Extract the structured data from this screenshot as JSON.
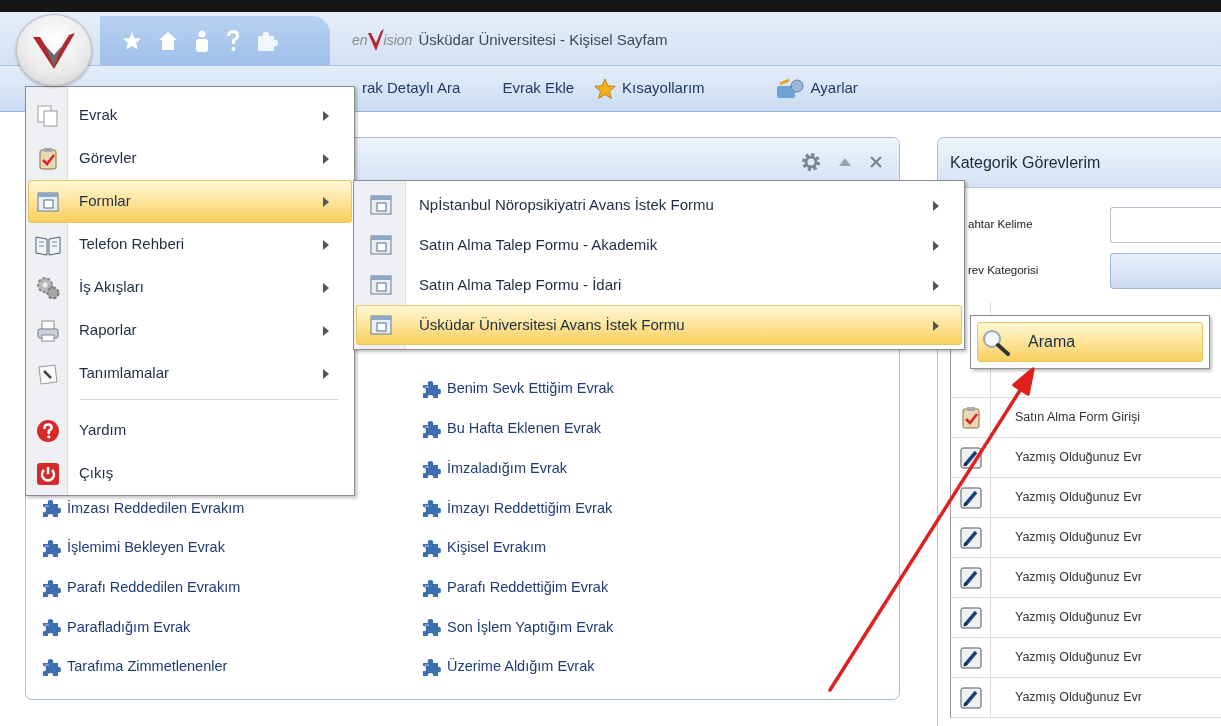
{
  "title_bar": {
    "logo": {
      "before": "en",
      "after": "ision"
    },
    "title": "Üsküdar Üniversitesi - Kişisel Sayfam"
  },
  "menu_bar": [
    {
      "label": "rak Detaylı Ara",
      "kind": "plain"
    },
    {
      "label": "Evrak Ekle",
      "kind": "plain"
    },
    {
      "label": "Kısayollarım",
      "kind": "star"
    },
    {
      "label": "Ayarlar",
      "kind": "settings"
    }
  ],
  "left_panel": {
    "columns": [
      [
        "İmzası Reddedilen Evrakım",
        "İşlemimi Bekleyen Evrak",
        "Parafı Reddedilen Evrakım",
        "Parafladığım Evrak",
        "Tarafıma Zimmetlenenler"
      ],
      [
        "Benim Sevk Ettiğim Evrak",
        "Bu Hafta Eklenen Evrak",
        "İmzaladığım Evrak",
        "İmzayı Reddettiğim Evrak",
        "Kişisel Evrakım",
        "Parafı Reddettiğim Evrak",
        "Son İşlem Yaptığım Evrak",
        "Üzerime Aldığım Evrak"
      ]
    ]
  },
  "right_panel": {
    "title": "Kategorik Görevlerim",
    "fields": [
      {
        "label": "ahtar Kelime",
        "kind": "text"
      },
      {
        "label": "rev Kategorisi",
        "kind": "dropdown"
      }
    ],
    "rows": [
      {
        "kind": "task",
        "text": "Satın Alma Form Girişi"
      },
      {
        "kind": "document",
        "text": "Yazmış Olduğunuz Evr"
      },
      {
        "kind": "document",
        "text": "Yazmış Olduğunuz Evr"
      },
      {
        "kind": "document",
        "text": "Yazmış Olduğunuz Evr"
      },
      {
        "kind": "document",
        "text": "Yazmış Olduğunuz Evr"
      },
      {
        "kind": "document",
        "text": "Yazmış Olduğunuz Evr"
      },
      {
        "kind": "document",
        "text": "Yazmış Olduğunuz Evr"
      },
      {
        "kind": "document",
        "text": "Yazmış Olduğunuz Evr"
      }
    ]
  },
  "start_menu": {
    "items": [
      {
        "label": "Evrak",
        "kind": "documents",
        "has_submenu": true,
        "separator_before": false,
        "selected": false
      },
      {
        "label": "Görevler",
        "kind": "clipboard",
        "has_submenu": true,
        "separator_before": false,
        "selected": false
      },
      {
        "label": "Formlar",
        "kind": "form",
        "has_submenu": true,
        "separator_before": false,
        "selected": true
      },
      {
        "label": "Telefon Rehberi",
        "kind": "book",
        "has_submenu": true,
        "separator_before": false,
        "selected": false
      },
      {
        "label": "İş Akışları",
        "kind": "gears",
        "has_submenu": true,
        "separator_before": false,
        "selected": false
      },
      {
        "label": "Raporlar",
        "kind": "printer",
        "has_submenu": true,
        "separator_before": false,
        "selected": false
      },
      {
        "label": "Tanımlamalar",
        "kind": "pen",
        "has_submenu": true,
        "separator_before": false,
        "selected": false
      },
      {
        "label": "Yardım",
        "kind": "help",
        "has_submenu": false,
        "separator_before": true,
        "selected": false
      },
      {
        "label": "Çıkış",
        "kind": "power",
        "has_submenu": false,
        "separator_before": false,
        "selected": false
      }
    ]
  },
  "forms_submenu": {
    "items": [
      {
        "label": "Npİstanbul Nöropsikiyatri Avans İstek Formu",
        "selected": false
      },
      {
        "label": "Satın Alma Talep Formu - Akademik",
        "selected": false
      },
      {
        "label": "Satın Alma Talep Formu - İdari",
        "selected": false
      },
      {
        "label": "Üsküdar Üniversitesi Avans İstek Formu",
        "selected": true
      }
    ]
  },
  "search_submenu": {
    "items": [
      {
        "label": "Arama",
        "selected": true
      }
    ]
  }
}
